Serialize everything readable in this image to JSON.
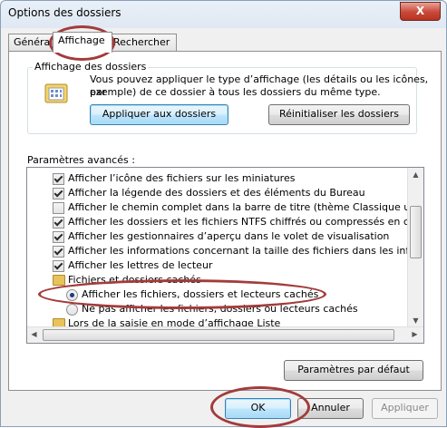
{
  "window": {
    "title": "Options des dossiers",
    "close_symbol": "X"
  },
  "tabs": [
    {
      "label": "Général"
    },
    {
      "label": "Affichage"
    },
    {
      "label": "Rechercher"
    }
  ],
  "folder_view": {
    "group_label": "Affichage des dossiers",
    "description_line1": "Vous pouvez appliquer le type d’affichage (les détails ou les icônes, par",
    "description_line2": "exemple) de ce dossier à tous les dossiers du même type.",
    "apply_label": "Appliquer aux dossiers",
    "reset_label": "Réinitialiser les dossiers"
  },
  "advanced": {
    "label": "Paramètres avancés :",
    "items": [
      {
        "type": "checkbox",
        "checked": true,
        "label": "Afficher l’icône des fichiers sur les miniatures"
      },
      {
        "type": "checkbox",
        "checked": true,
        "label": "Afficher la légende des dossiers et des éléments du Bureau"
      },
      {
        "type": "checkbox",
        "checked": false,
        "label": "Afficher le chemin complet dans la barre de titre (thème Classique uniquement)"
      },
      {
        "type": "checkbox",
        "checked": true,
        "label": "Afficher les dossiers et les fichiers NTFS chiffrés ou compressés en couleur"
      },
      {
        "type": "checkbox",
        "checked": true,
        "label": "Afficher les gestionnaires d’aperçu dans le volet de visualisation"
      },
      {
        "type": "checkbox",
        "checked": true,
        "label": "Afficher les informations concernant la taille des fichiers dans les info-bulles du d"
      },
      {
        "type": "checkbox",
        "checked": true,
        "label": "Afficher les lettres de lecteur"
      },
      {
        "type": "folder",
        "label": "Fichiers et dossiers cachés"
      },
      {
        "type": "radio",
        "checked": true,
        "label": "Afficher les fichiers, dossiers et lecteurs cachés"
      },
      {
        "type": "radio",
        "checked": false,
        "label": "Ne pas afficher les fichiers, dossiers ou lecteurs cachés"
      },
      {
        "type": "checkbox",
        "checked": false,
        "label": "Lors de la saisie en mode d’affichage Liste"
      }
    ],
    "default_label": "Paramètres par défaut"
  },
  "footer": {
    "ok_label": "OK",
    "cancel_label": "Annuler",
    "apply_label": "Appliquer"
  },
  "colors": {
    "highlight_ellipse": "#a33b3b",
    "focus_border": "#3c7fb1"
  }
}
